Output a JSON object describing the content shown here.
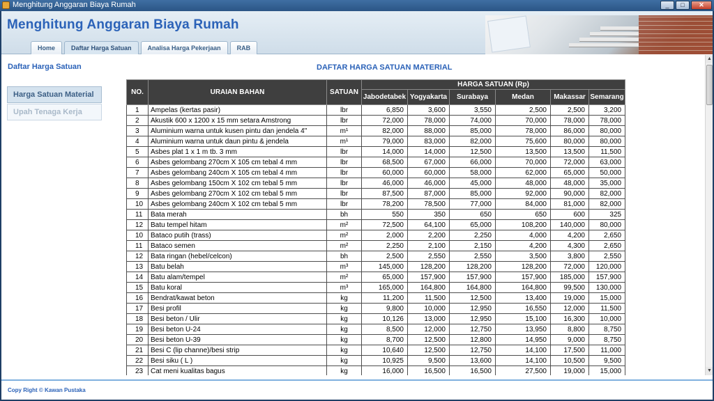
{
  "window": {
    "title": "Menghitung Anggaran Biaya Rumah",
    "btn_min": "_",
    "btn_max": "□",
    "btn_close": "✕"
  },
  "header": {
    "app_title": "Menghitung Anggaran Biaya Rumah"
  },
  "tabs": [
    {
      "label": "Home"
    },
    {
      "label": "Daftar Harga Satuan",
      "active": true
    },
    {
      "label": "Analisa Harga Pekerjaan"
    },
    {
      "label": "RAB"
    }
  ],
  "sidebar": {
    "title": "Daftar Harga Satuan",
    "items": [
      {
        "label": "Harga Satuan Material",
        "active": true
      },
      {
        "label": "Upah Tenaga Kerja"
      }
    ]
  },
  "main": {
    "title": "DAFTAR HARGA SATUAN MATERIAL",
    "table": {
      "head": {
        "no": "NO.",
        "uraian": "URAIAN BAHAN",
        "satuan": "SATUAN",
        "harga": "HARGA SATUAN (Rp)"
      },
      "cities": [
        "Jabodetabek",
        "Yogyakarta",
        "Surabaya",
        "Medan",
        "Makassar",
        "Semarang"
      ],
      "rows": [
        {
          "no": "1",
          "item": "Ampelas (kertas pasir)",
          "unit": "lbr",
          "prices": [
            "6,850",
            "3,600",
            "3,550",
            "2,500",
            "2,500",
            "3,200"
          ]
        },
        {
          "no": "2",
          "item": "Akustik 600 x 1200 x 15 mm setara Amstrong",
          "unit": "lbr",
          "prices": [
            "72,000",
            "78,000",
            "74,000",
            "70,000",
            "78,000",
            "78,000"
          ]
        },
        {
          "no": "3",
          "item": "Aluminium warna untuk kusen pintu dan jendela 4\"",
          "unit": "m¹",
          "prices": [
            "82,000",
            "88,000",
            "85,000",
            "78,000",
            "86,000",
            "80,000"
          ]
        },
        {
          "no": "4",
          "item": "Aluminium warna untuk daun pintu & jendela",
          "unit": "m¹",
          "prices": [
            "79,000",
            "83,000",
            "82,000",
            "75,600",
            "80,000",
            "80,000"
          ]
        },
        {
          "no": "5",
          "item": "Asbes plat 1 x 1 m tb. 3 mm",
          "unit": "lbr",
          "prices": [
            "14,000",
            "14,000",
            "12,500",
            "13,500",
            "13,500",
            "11,500"
          ]
        },
        {
          "no": "6",
          "item": "Asbes gelombang 270cm X 105 cm tebal 4 mm",
          "unit": "lbr",
          "prices": [
            "68,500",
            "67,000",
            "66,000",
            "70,000",
            "72,000",
            "63,000"
          ]
        },
        {
          "no": "7",
          "item": "Asbes gelombang 240cm X 105 cm tebal 4 mm",
          "unit": "lbr",
          "prices": [
            "60,000",
            "60,000",
            "58,000",
            "62,000",
            "65,000",
            "50,000"
          ]
        },
        {
          "no": "8",
          "item": "Asbes gelombang 150cm X 102 cm tebal 5 mm",
          "unit": "lbr",
          "prices": [
            "46,000",
            "46,000",
            "45,000",
            "48,000",
            "48,000",
            "35,000"
          ]
        },
        {
          "no": "9",
          "item": "Asbes gelombang 270cm X 102 cm tebal 5 mm",
          "unit": "lbr",
          "prices": [
            "87,500",
            "87,000",
            "85,000",
            "92,000",
            "90,000",
            "82,000"
          ]
        },
        {
          "no": "10",
          "item": "Asbes gelombang 240cm X 102 cm tebal 5 mm",
          "unit": "lbr",
          "prices": [
            "78,200",
            "78,500",
            "77,000",
            "84,000",
            "81,000",
            "82,000"
          ]
        },
        {
          "no": "11",
          "item": "Bata merah",
          "unit": "bh",
          "prices": [
            "550",
            "350",
            "650",
            "650",
            "600",
            "325"
          ]
        },
        {
          "no": "12",
          "item": "Batu tempel hitam",
          "unit": "m²",
          "prices": [
            "72,500",
            "64,100",
            "65,000",
            "108,200",
            "140,000",
            "80,000"
          ]
        },
        {
          "no": "10",
          "item": "Bataco putih (trass)",
          "unit": "m²",
          "prices": [
            "2,000",
            "2,200",
            "2,250",
            "4,000",
            "4,200",
            "2,650"
          ]
        },
        {
          "no": "11",
          "item": "Bataco semen",
          "unit": "m²",
          "prices": [
            "2,250",
            "2,100",
            "2,150",
            "4,200",
            "4,300",
            "2,650"
          ]
        },
        {
          "no": "12",
          "item": "Bata ringan (hebel/celcon)",
          "unit": "bh",
          "prices": [
            "2,500",
            "2,550",
            "2,550",
            "3,500",
            "3,800",
            "2,550"
          ]
        },
        {
          "no": "13",
          "item": "Batu belah",
          "unit": "m³",
          "prices": [
            "145,000",
            "128,200",
            "128,200",
            "128,200",
            "72,000",
            "120,000"
          ]
        },
        {
          "no": "14",
          "item": "Batu alam/tempel",
          "unit": "m²",
          "prices": [
            "65,000",
            "157,900",
            "157,900",
            "157,900",
            "185,000",
            "157,900"
          ]
        },
        {
          "no": "15",
          "item": "Batu koral",
          "unit": "m³",
          "prices": [
            "165,000",
            "164,800",
            "164,800",
            "164,800",
            "99,500",
            "130,000"
          ]
        },
        {
          "no": "16",
          "item": "Bendrat/kawat beton",
          "unit": "kg",
          "prices": [
            "11,200",
            "11,500",
            "12,500",
            "13,400",
            "19,000",
            "15,000"
          ]
        },
        {
          "no": "17",
          "item": "Besi profil",
          "unit": "kg",
          "prices": [
            "9,800",
            "10,000",
            "12,950",
            "16,550",
            "12,000",
            "11,500"
          ]
        },
        {
          "no": "18",
          "item": "Besi beton / Ulir",
          "unit": "kg",
          "prices": [
            "10,126",
            "13,000",
            "12,950",
            "15,100",
            "16,300",
            "10,000"
          ]
        },
        {
          "no": "19",
          "item": "Besi beton  U-24",
          "unit": "kg",
          "prices": [
            "8,500",
            "12,000",
            "12,750",
            "13,950",
            "8,800",
            "8,750"
          ]
        },
        {
          "no": "20",
          "item": "Besi beton  U-39",
          "unit": "kg",
          "prices": [
            "8,700",
            "12,500",
            "12,800",
            "14,950",
            "9,000",
            "8,750"
          ]
        },
        {
          "no": "21",
          "item": "Besi C (lip channe)/besi strip",
          "unit": "kg",
          "prices": [
            "10,640",
            "12,500",
            "12,750",
            "14,100",
            "17,500",
            "11,000"
          ]
        },
        {
          "no": "22",
          "item": "Besi siku ( L )",
          "unit": "kg",
          "prices": [
            "10,925",
            "9,500",
            "13,600",
            "14,100",
            "10,500",
            "9,500"
          ]
        },
        {
          "no": "23",
          "item": "Cat meni kualitas bagus",
          "unit": "kg",
          "prices": [
            "16,000",
            "16,500",
            "16,500",
            "27,500",
            "19,000",
            "15,000"
          ]
        }
      ]
    }
  },
  "footer": {
    "text": "Copy Right © Kawan Pustaka"
  },
  "colors": {
    "accent": "#2b62b8",
    "header_bg": "#3f3f3f",
    "footer_line": "#7fb0df"
  }
}
